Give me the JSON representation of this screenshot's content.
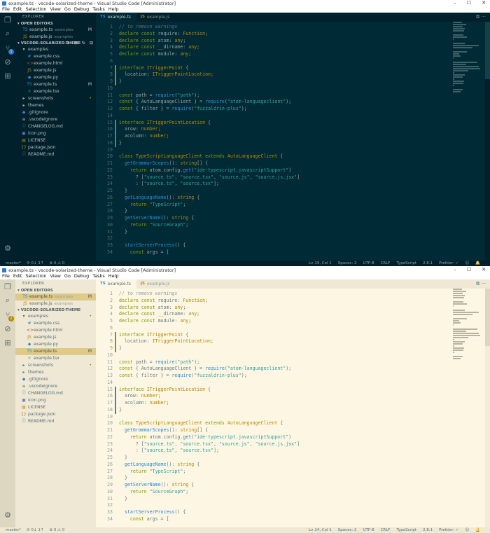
{
  "windows": [
    {
      "theme": "dark",
      "window_title": "example.ts - vscode-solarized-theme - Visual Studio Code [Administrator]",
      "menu": [
        "File",
        "Edit",
        "Selection",
        "View",
        "Go",
        "Debug",
        "Tasks",
        "Help"
      ],
      "window_buttons": {
        "minimize": "–",
        "maximize": "☐",
        "close": "✕"
      },
      "activity_badge": "1",
      "sidebar": {
        "title": "EXPLORER",
        "open_editors_label": "OPEN EDITORS",
        "open_editors": [
          {
            "name": "example.ts",
            "hint": "examples",
            "mark": "M",
            "icon": "TS",
            "active": false
          },
          {
            "name": "example.js",
            "hint": "examples",
            "mark": "",
            "icon": "JS",
            "active": false
          }
        ],
        "project_label": "VSCODE-SOLARIZED-THEME",
        "project_tools": "⊕ ⊞ ↻ ⊟",
        "tree": [
          {
            "name": "examples",
            "depth": 0,
            "folder": true,
            "open": true,
            "mark": "",
            "icon": "▾"
          },
          {
            "name": "example.css",
            "depth": 1,
            "mark": "",
            "icon": "#"
          },
          {
            "name": "example.html",
            "depth": 1,
            "mark": "",
            "icon": "<>"
          },
          {
            "name": "example.js",
            "depth": 1,
            "mark": "",
            "icon": "JS"
          },
          {
            "name": "example.py",
            "depth": 1,
            "mark": "",
            "icon": "◆"
          },
          {
            "name": "example.ts",
            "depth": 1,
            "mark": "M",
            "icon": "TS"
          },
          {
            "name": "example.tsx",
            "depth": 1,
            "mark": "",
            "icon": "⚛"
          },
          {
            "name": "screenshots",
            "depth": 0,
            "folder": true,
            "open": false,
            "mark": "•",
            "icon": "▸"
          },
          {
            "name": "themes",
            "depth": 0,
            "folder": true,
            "open": false,
            "mark": "",
            "icon": "▸"
          },
          {
            "name": ".gitignore",
            "depth": 0,
            "mark": "",
            "icon": "◆"
          },
          {
            "name": ".vscodeignore",
            "depth": 0,
            "mark": "",
            "icon": "≡"
          },
          {
            "name": "CHANGELOG.md",
            "depth": 0,
            "mark": "",
            "icon": "ⓘ"
          },
          {
            "name": "icon.png",
            "depth": 0,
            "mark": "",
            "icon": "▣"
          },
          {
            "name": "LICENSE",
            "depth": 0,
            "mark": "",
            "icon": "▤"
          },
          {
            "name": "package.json",
            "depth": 0,
            "mark": "",
            "icon": "{}"
          },
          {
            "name": "README.md",
            "depth": 0,
            "mark": "",
            "icon": "ⓘ"
          }
        ]
      },
      "tabs": [
        {
          "label": "example.ts",
          "icon": "TS",
          "active": true
        },
        {
          "label": "example.js",
          "icon": "JS",
          "active": false
        }
      ],
      "tab_actions": "⧉ ···",
      "code_start_line": 1,
      "status": {
        "branch": "master*",
        "sync": "⟳ 0↓ 1↑",
        "problems": "⊗ 0  ⚠ 0",
        "position": "Ln 19, Col 1",
        "spaces": "Spaces: 2",
        "encoding": "UTF-8",
        "eol": "CRLF",
        "language": "TypeScript",
        "version": "2.8.1",
        "prettier": "Prettier: ✓",
        "emoji": "☺",
        "bell": "🔔"
      }
    },
    {
      "theme": "light",
      "window_title": "example.ts - vscode-solarized-theme - Visual Studio Code [Administrator]",
      "menu": [
        "File",
        "Edit",
        "Selection",
        "View",
        "Go",
        "Debug",
        "Tasks",
        "Help"
      ],
      "window_buttons": {
        "minimize": "–",
        "maximize": "☐",
        "close": "✕"
      },
      "activity_badge": "2",
      "sidebar": {
        "title": "EXPLORER",
        "open_editors_label": "OPEN EDITORS",
        "open_editors": [
          {
            "name": "example.ts",
            "hint": "examples",
            "mark": "M",
            "icon": "TS",
            "active": true
          },
          {
            "name": "example.js",
            "hint": "examples",
            "mark": "",
            "icon": "JS",
            "active": false
          }
        ],
        "project_label": "VSCODE-SOLARIZED-THEME",
        "project_tools": "",
        "tree": [
          {
            "name": "examples",
            "depth": 0,
            "folder": true,
            "open": true,
            "mark": "•",
            "icon": "▾"
          },
          {
            "name": "example.css",
            "depth": 1,
            "mark": "",
            "icon": "#"
          },
          {
            "name": "example.html",
            "depth": 1,
            "mark": "",
            "icon": "<>"
          },
          {
            "name": "example.js",
            "depth": 1,
            "mark": "",
            "icon": "JS"
          },
          {
            "name": "example.py",
            "depth": 1,
            "mark": "",
            "icon": "◆"
          },
          {
            "name": "example.ts",
            "depth": 1,
            "mark": "M",
            "icon": "TS",
            "active": true
          },
          {
            "name": "example.tsx",
            "depth": 1,
            "mark": "",
            "icon": "⚛"
          },
          {
            "name": "screenshots",
            "depth": 0,
            "folder": true,
            "open": false,
            "mark": "•",
            "icon": "▸"
          },
          {
            "name": "themes",
            "depth": 0,
            "folder": true,
            "open": false,
            "mark": "",
            "icon": "▸"
          },
          {
            "name": ".gitignore",
            "depth": 0,
            "mark": "",
            "icon": "◆"
          },
          {
            "name": ".vscodeignore",
            "depth": 0,
            "mark": "",
            "icon": "≡"
          },
          {
            "name": "CHANGELOG.md",
            "depth": 0,
            "mark": "",
            "icon": "ⓘ"
          },
          {
            "name": "icon.png",
            "depth": 0,
            "mark": "",
            "icon": "▣"
          },
          {
            "name": "LICENSE",
            "depth": 0,
            "mark": "",
            "icon": "▤"
          },
          {
            "name": "package.json",
            "depth": 0,
            "mark": "",
            "icon": "{}"
          },
          {
            "name": "README.md",
            "depth": 0,
            "mark": "",
            "icon": "ⓘ"
          }
        ]
      },
      "tabs": [
        {
          "label": "example.ts",
          "icon": "TS",
          "active": true
        },
        {
          "label": "example.js",
          "icon": "JS",
          "active": false
        }
      ],
      "tab_actions": "⧉ ···",
      "code_start_line": 1,
      "status": {
        "branch": "master*",
        "sync": "⟳ 0↓ 1↑",
        "problems": "⊗ 0  ⚠ 0",
        "position": "Ln 14, Col 1",
        "spaces": "Spaces: 2",
        "encoding": "UTF-8",
        "eol": "CRLF",
        "language": "TypeScript",
        "version": "2.8.1",
        "prettier": "Prettier: ✓",
        "emoji": "☺",
        "bell": "🔔"
      }
    }
  ],
  "code_lines": [
    [
      [
        "c",
        "// to remove warnings"
      ]
    ],
    [
      [
        "k",
        "declare const "
      ],
      [
        "p",
        "require: "
      ],
      [
        "t",
        "Function"
      ],
      [
        "p",
        ";"
      ]
    ],
    [
      [
        "k",
        "declare const "
      ],
      [
        "p",
        "atom: "
      ],
      [
        "t",
        "any"
      ],
      [
        "p",
        ";"
      ]
    ],
    [
      [
        "k",
        "declare const "
      ],
      [
        "p",
        "__dirname: "
      ],
      [
        "t",
        "any"
      ],
      [
        "p",
        ";"
      ]
    ],
    [
      [
        "k",
        "declare const "
      ],
      [
        "p",
        "module: "
      ],
      [
        "t",
        "any"
      ],
      [
        "p",
        ";"
      ]
    ],
    [],
    [
      [
        "k",
        "interface "
      ],
      [
        "t",
        "ITriggerPoint"
      ],
      [
        "p",
        " {"
      ]
    ],
    [
      [
        "p",
        "  location: "
      ],
      [
        "t",
        "ITriggerPointLocation"
      ],
      [
        "p",
        ";"
      ]
    ],
    [
      [
        "p",
        "}"
      ]
    ],
    [],
    [
      [
        "k",
        "const "
      ],
      [
        "p",
        "path = "
      ],
      [
        "f",
        "require"
      ],
      [
        "p",
        "("
      ],
      [
        "s",
        "\"path\""
      ],
      [
        "p",
        ");"
      ]
    ],
    [
      [
        "k",
        "const "
      ],
      [
        "p",
        "{ AutoLanguageClient } = "
      ],
      [
        "f",
        "require"
      ],
      [
        "p",
        "("
      ],
      [
        "s",
        "\"atom-languageclient\""
      ],
      [
        "p",
        ");"
      ]
    ],
    [
      [
        "k",
        "const "
      ],
      [
        "p",
        "{ filter } = "
      ],
      [
        "f",
        "require"
      ],
      [
        "p",
        "("
      ],
      [
        "s",
        "\"fuzzaldrin-plus\""
      ],
      [
        "p",
        ");"
      ]
    ],
    [],
    [
      [
        "k",
        "interface "
      ],
      [
        "t",
        "ITriggerPointLocation"
      ],
      [
        "p",
        " {"
      ]
    ],
    [
      [
        "p",
        "  arow: "
      ],
      [
        "t",
        "number"
      ],
      [
        "p",
        ";"
      ]
    ],
    [
      [
        "p",
        "  acolumn: "
      ],
      [
        "t",
        "number"
      ],
      [
        "p",
        ";"
      ]
    ],
    [
      [
        "p",
        "}"
      ]
    ],
    [],
    [
      [
        "k",
        "class "
      ],
      [
        "t",
        "TypeScriptLanguageClient "
      ],
      [
        "k",
        "extends "
      ],
      [
        "t",
        "AutoLanguageClient"
      ],
      [
        "p",
        " {"
      ]
    ],
    [
      [
        "p",
        "  "
      ],
      [
        "f",
        "getGrammarScopes"
      ],
      [
        "p",
        "(): "
      ],
      [
        "t",
        "string"
      ],
      [
        "p",
        "[] {"
      ]
    ],
    [
      [
        "k",
        "    return "
      ],
      [
        "p",
        "atom.config."
      ],
      [
        "f",
        "get"
      ],
      [
        "p",
        "("
      ],
      [
        "s",
        "\"ide-typescript.javascriptSupport\""
      ],
      [
        "p",
        ")"
      ]
    ],
    [
      [
        "p",
        "      ? ["
      ],
      [
        "s",
        "\"source.ts\""
      ],
      [
        "p",
        ", "
      ],
      [
        "s",
        "\"source.tsx\""
      ],
      [
        "p",
        ", "
      ],
      [
        "s",
        "\"source.js\""
      ],
      [
        "p",
        ", "
      ],
      [
        "s",
        "\"source.js.jsx\""
      ],
      [
        "p",
        "]"
      ]
    ],
    [
      [
        "p",
        "      : ["
      ],
      [
        "s",
        "\"source.ts\""
      ],
      [
        "p",
        ", "
      ],
      [
        "s",
        "\"source.tsx\""
      ],
      [
        "p",
        "];"
      ]
    ],
    [
      [
        "p",
        "  }"
      ]
    ],
    [
      [
        "p",
        "  "
      ],
      [
        "f",
        "getLanguageName"
      ],
      [
        "p",
        "(): "
      ],
      [
        "t",
        "string"
      ],
      [
        "p",
        " {"
      ]
    ],
    [
      [
        "k",
        "    return "
      ],
      [
        "s",
        "\"TypeScript\""
      ],
      [
        "p",
        ";"
      ]
    ],
    [
      [
        "p",
        "  }"
      ]
    ],
    [
      [
        "p",
        "  "
      ],
      [
        "f",
        "getServerName"
      ],
      [
        "p",
        "(): "
      ],
      [
        "t",
        "string"
      ],
      [
        "p",
        " {"
      ]
    ],
    [
      [
        "k",
        "    return "
      ],
      [
        "s",
        "\"SourceGraph\""
      ],
      [
        "p",
        ";"
      ]
    ],
    [
      [
        "p",
        "  }"
      ]
    ],
    [],
    [
      [
        "p",
        "  "
      ],
      [
        "f",
        "startServerProcess"
      ],
      [
        "p",
        "() {"
      ]
    ],
    [
      [
        "k",
        "    const "
      ],
      [
        "p",
        "args = ["
      ]
    ]
  ],
  "gutter_marks": [
    {
      "from": 7,
      "to": 9,
      "color": "#859900"
    },
    {
      "from": 15,
      "to": 18,
      "color": "#268bd2"
    }
  ],
  "colors": {
    "dark_bg": "#002b36",
    "light_bg": "#fdf6e3",
    "keyword": "#859900",
    "string": "#2aa198",
    "type": "#b58900",
    "function": "#268bd2"
  }
}
